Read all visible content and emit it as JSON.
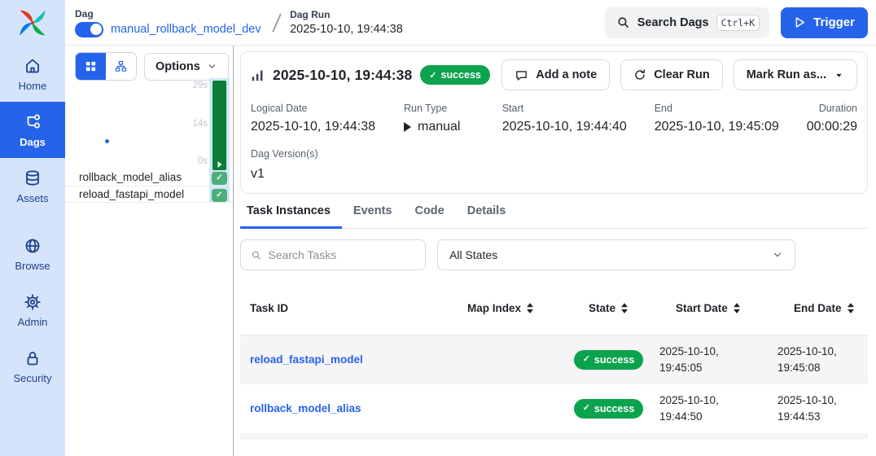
{
  "colors": {
    "accent": "#2563eb",
    "success": "#0ba34e",
    "success-bar": "#0c7d35",
    "success-square": "#4caf79",
    "sidebar-bg": "#d5e4fb",
    "sidebar-text": "#1d4289",
    "col-highlight": "#cfe7f7"
  },
  "sidebar": {
    "items": [
      {
        "label": "Home",
        "icon": "home-icon",
        "active": false
      },
      {
        "label": "Dags",
        "icon": "dag-icon",
        "active": true
      },
      {
        "label": "Assets",
        "icon": "database-icon",
        "active": false
      },
      {
        "label": "Browse",
        "icon": "globe-icon",
        "active": false
      },
      {
        "label": "Admin",
        "icon": "gear-icon",
        "active": false
      },
      {
        "label": "Security",
        "icon": "lock-icon",
        "active": false
      }
    ]
  },
  "topbar": {
    "dag_label": "Dag",
    "dag_toggle_state": "on",
    "dag_name": "manual_rollback_model_dev",
    "dag_run_label": "Dag Run",
    "dag_run_id": "2025-10-10, 19:44:38",
    "search_label": "Search Dags",
    "search_shortcut": "Ctrl+K",
    "trigger_label": "Trigger"
  },
  "grid_panel": {
    "options_label": "Options",
    "axis_ticks": [
      "29s",
      "14s",
      "0s"
    ],
    "run_state": "success",
    "tasks": [
      {
        "name": "rollback_model_alias",
        "state": "success"
      },
      {
        "name": "reload_fastapi_model",
        "state": "success"
      }
    ]
  },
  "run": {
    "title": "2025-10-10, 19:44:38",
    "status": "success",
    "buttons": {
      "add_note": "Add a note",
      "clear_run": "Clear Run",
      "mark_run_as": "Mark Run as..."
    },
    "meta": [
      {
        "label": "Logical Date",
        "value": "2025-10-10, 19:44:38"
      },
      {
        "label": "Run Type",
        "value": "manual"
      },
      {
        "label": "Start",
        "value": "2025-10-10, 19:44:40"
      },
      {
        "label": "End",
        "value": "2025-10-10, 19:45:09"
      },
      {
        "label": "Duration",
        "value": "00:00:29"
      }
    ],
    "dag_versions_label": "Dag Version(s)",
    "dag_versions_value": "v1"
  },
  "tabs": [
    {
      "label": "Task Instances",
      "active": true
    },
    {
      "label": "Events",
      "active": false
    },
    {
      "label": "Code",
      "active": false
    },
    {
      "label": "Details",
      "active": false
    }
  ],
  "filters": {
    "search_placeholder": "Search Tasks",
    "state_filter": "All States"
  },
  "table": {
    "columns": [
      "Task ID",
      "Map Index",
      "State",
      "Start Date",
      "End Date"
    ],
    "rows": [
      {
        "task_id": "reload_fastapi_model",
        "map_index": "",
        "state": "success",
        "start_date": "2025-10-10, 19:45:05",
        "end_date": "2025-10-10, 19:45:08"
      },
      {
        "task_id": "rollback_model_alias",
        "map_index": "",
        "state": "success",
        "start_date": "2025-10-10, 19:44:50",
        "end_date": "2025-10-10, 19:44:53"
      }
    ]
  }
}
